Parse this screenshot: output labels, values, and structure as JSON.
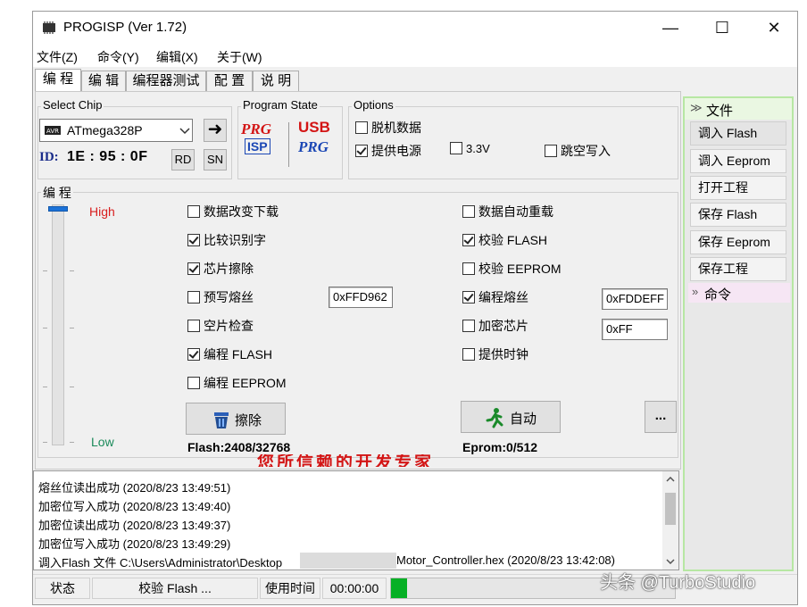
{
  "titlebar": {
    "title": "PROGISP (Ver 1.72)",
    "minimize": "—",
    "maximize": "☐",
    "close": "✕"
  },
  "menu": [
    "文件(Z)",
    "命令(Y)",
    "编辑(X)",
    "关于(W)"
  ],
  "tabs": [
    "编 程",
    "编 辑",
    "编程器测试",
    "配 置",
    "说 明"
  ],
  "select_chip": {
    "label": "Select Chip",
    "value": "ATmega328P",
    "id_label": "ID:",
    "id_value": "1E : 95 : 0F",
    "rd": "RD",
    "sn": "SN",
    "arrow": "➜"
  },
  "program_state": {
    "label": "Program State",
    "prg": "PRG",
    "isp": "ISP",
    "usb": "USB",
    "prg2": "PRG"
  },
  "options": {
    "label": "Options",
    "offline": "脱机数据",
    "offline_checked": false,
    "power": "提供电源",
    "power_checked": true,
    "v33": "3.3V",
    "v33_checked": false,
    "skip": "跳空写入",
    "skip_checked": false
  },
  "program": {
    "label": "编 程",
    "high": "High",
    "low": "Low",
    "left_opts": [
      {
        "label": "数据改变下载",
        "checked": false
      },
      {
        "label": "比较识别字",
        "checked": true
      },
      {
        "label": "芯片擦除",
        "checked": true
      },
      {
        "label": "预写熔丝",
        "checked": false
      },
      {
        "label": "空片检查",
        "checked": false
      },
      {
        "label": "编程 FLASH",
        "checked": true
      },
      {
        "label": "编程 EEPROM",
        "checked": false
      }
    ],
    "right_opts": [
      {
        "label": "数据自动重载",
        "checked": false
      },
      {
        "label": "校验 FLASH",
        "checked": true
      },
      {
        "label": "校验 EEPROM",
        "checked": false
      },
      {
        "label": "编程熔丝",
        "checked": true
      },
      {
        "label": "加密芯片",
        "checked": false
      },
      {
        "label": "提供时钟",
        "checked": false
      }
    ],
    "prefuse_value": "0xFFD962",
    "fuse_value": "0xFDDEFF",
    "lock_value": "0xFF",
    "erase_button": "擦除",
    "auto_button": "自动",
    "more_button": "...",
    "flash_usage": "Flash:2408/32768",
    "eprom_usage": "Eprom:0/512",
    "slogan": "您所信赖的开发专家"
  },
  "sidebar": {
    "file_header": "文件",
    "items": [
      "调入 Flash",
      "调入 Eeprom",
      "打开工程",
      "保存 Flash",
      "保存 Eeprom",
      "保存工程"
    ],
    "command_header": "命令"
  },
  "log": [
    "熔丝位读出成功 (2020/8/23 13:49:51)",
    "加密位写入成功 (2020/8/23 13:49:40)",
    "加密位读出成功 (2020/8/23 13:49:37)",
    "加密位写入成功 (2020/8/23 13:49:29)",
    "调入Flash 文件 C:\\Users\\Administrator\\Desktop",
    "Motor_Controller.hex (2020/8/23 13:42:08)"
  ],
  "statusbar": {
    "state": "状态",
    "verify": "校验 Flash ...",
    "time_label": "使用时间",
    "time_value": "00:00:00",
    "progress": 0.02
  },
  "watermark": "头条 @TurboStudio"
}
